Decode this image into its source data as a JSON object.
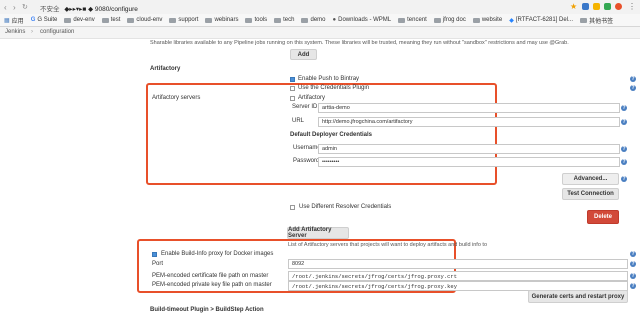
{
  "browser": {
    "url_prefix": "不安全",
    "url_host_masked": "◆▸▸▾▸■ ◆",
    "url_path": "9080/configure",
    "bookmarks": [
      "应用",
      "G Suite",
      "dev-env",
      "test",
      "cloud-env",
      "support",
      "webinars",
      "tools",
      "tech",
      "demo",
      "Downloads - WPML",
      "tencent",
      "jfrog doc",
      "website",
      "[RTFACT-6281] Del...",
      "其他书签"
    ]
  },
  "breadcrumb": {
    "root": "Jenkins",
    "sep": "›",
    "page": "configuration"
  },
  "shared_libraries_text": "Sharable libraries available to any Pipeline jobs running on this system. These libraries will be trusted, meaning they run without \"sandbox\" restrictions and may use @Grab.",
  "add_button": "Add",
  "artifactory": {
    "section_title": "Artifactory",
    "enable_push_bintray": "Enable Push to Bintray",
    "use_credentials_plugin": "Use the Credentials Plugin",
    "servers_label": "Artifactory servers",
    "artifactory_label": "Artifactory",
    "server_id_label": "Server ID",
    "server_id_value": "arttia-demo",
    "url_label": "URL",
    "url_value": "http://demo.jfrogchina.com/artifactory",
    "deployer_heading": "Default Deployer Credentials",
    "username_label": "Username",
    "username_value": "admin",
    "password_label": "Password",
    "password_value": "•••••••••",
    "advanced_button": "Advanced...",
    "test_connection_button": "Test Connection",
    "different_resolver": "Use Different Resolver Credentials",
    "delete_button": "Delete",
    "add_server_button": "Add Artifactory Server",
    "list_caption": "List of Artifactory servers that projects will want to deploy artifacts and build info to"
  },
  "docker_proxy": {
    "enable_label": "Enable Build-Info proxy for Docker images",
    "port_label": "Port",
    "port_value": "8092",
    "cert_label": "PEM-encoded certificate file path on master",
    "cert_value": "/root/.jenkins/secrets/jfrog/certs/jfrog.proxy.crt",
    "key_label": "PEM-encoded private key file path on master",
    "key_value": "/root/.jenkins/secrets/jfrog/certs/jfrog.proxy.key",
    "generate_button": "Generate certs and restart proxy"
  },
  "next_section": "Build-timeout Plugin > BuildStep Action",
  "colors": {
    "highlight": "#e8502a",
    "delete": "#d24939",
    "help": "#4a7fc1"
  }
}
